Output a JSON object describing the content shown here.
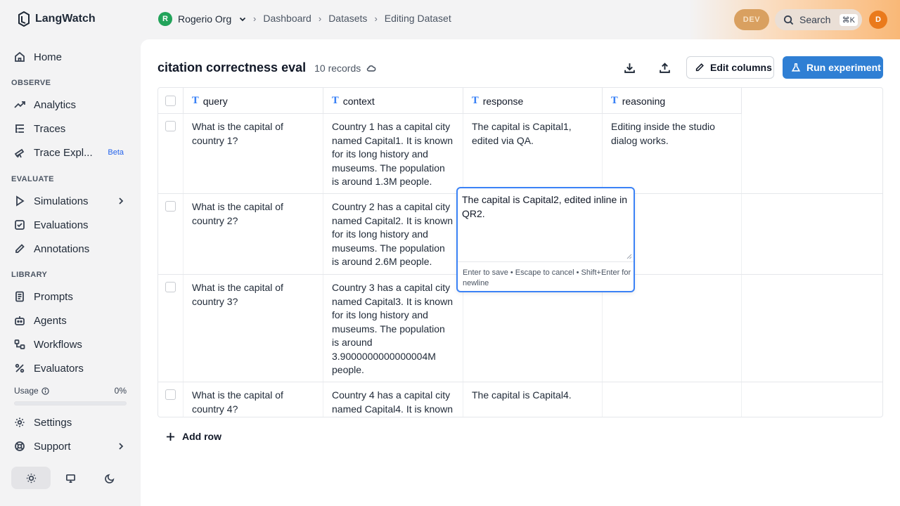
{
  "app": {
    "name": "LangWatch"
  },
  "sidebar": {
    "home": "Home",
    "observe_label": "OBSERVE",
    "analytics": "Analytics",
    "traces": "Traces",
    "trace_explorer": "Trace Expl...",
    "beta": "Beta",
    "evaluate_label": "EVALUATE",
    "simulations": "Simulations",
    "evaluations": "Evaluations",
    "annotations": "Annotations",
    "library_label": "LIBRARY",
    "prompts": "Prompts",
    "agents": "Agents",
    "workflows": "Workflows",
    "evaluators": "Evaluators",
    "usage_label": "Usage",
    "usage_pct": "0%",
    "usage_value": 0,
    "settings": "Settings",
    "support": "Support"
  },
  "header": {
    "org_initial": "R",
    "org_name": "Rogerio Org",
    "breadcrumb": [
      "Dashboard",
      "Datasets",
      "Editing Dataset"
    ],
    "env_badge": "DEV",
    "search_label": "Search",
    "search_shortcut": "⌘K",
    "user_initial": "D"
  },
  "dataset": {
    "title": "citation correctness eval",
    "records": "10 records",
    "edit_columns": "Edit columns",
    "run_experiment": "Run experiment",
    "add_row": "Add row"
  },
  "table": {
    "columns": [
      "query",
      "context",
      "response",
      "reasoning"
    ],
    "rows": [
      {
        "query": "What is the capital of country 1?",
        "context": "Country 1 has a capital city named Capital1. It is known for its long history and museums. The population is around 1.3M people.",
        "response": "The capital is Capital1, edited via QA.",
        "reasoning": "Editing inside the studio dialog works."
      },
      {
        "query": "What is the capital of country 2?",
        "context": "Country 2 has a capital city named Capital2. It is known for its long history and museums. The population is around 2.6M people.",
        "response": "",
        "reasoning": ""
      },
      {
        "query": "What is the capital of country 3?",
        "context": "Country 3 has a capital city named Capital3. It is known for its long history and museums. The population is around 3.9000000000000004M people.",
        "response": "",
        "reasoning": ""
      },
      {
        "query": "What is the capital of country 4?",
        "context": "Country 4 has a capital city named Capital4. It is known",
        "response": "The capital is Capital4.",
        "reasoning": ""
      }
    ]
  },
  "editor": {
    "value": "The capital is Capital2, edited inline in QR2.",
    "hint": "Enter to save • Escape to cancel • Shift+Enter for newline"
  }
}
